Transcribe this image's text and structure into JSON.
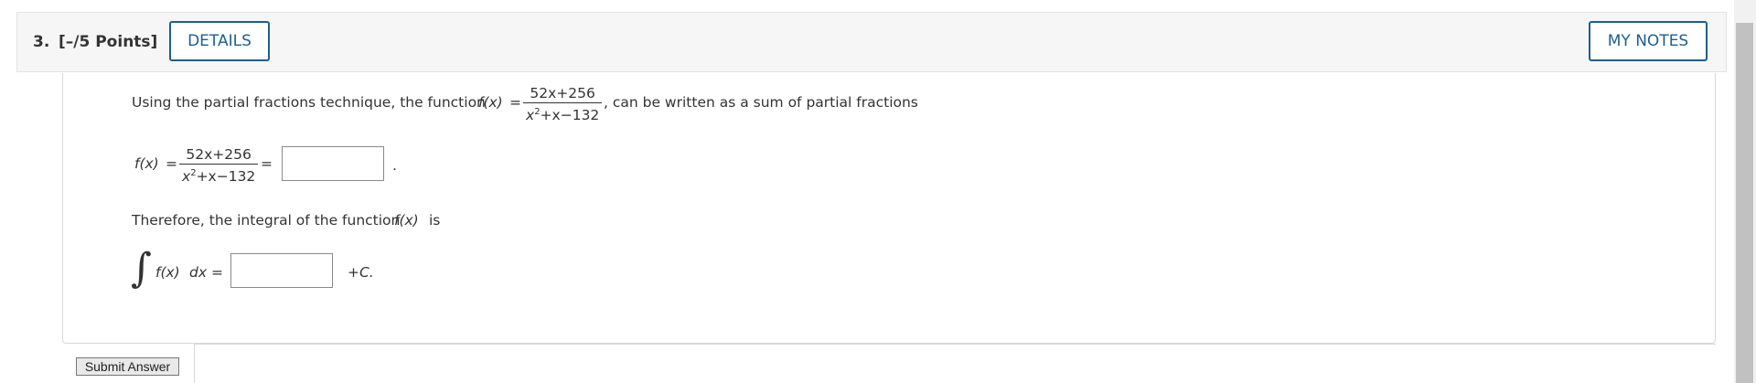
{
  "question": {
    "number": "3.",
    "points": "[–/5 Points]",
    "details_label": "DETAILS",
    "notes_label": "MY NOTES"
  },
  "problem": {
    "intro_before": "Using the partial fractions technique, the function",
    "fx": "f(x)",
    "equals": "=",
    "numerator": "52x+256",
    "denominator_base": "x",
    "denominator_exp": "2",
    "denominator_rest": "+x−132",
    "intro_after": ", can be written as a sum of partial fractions",
    "period": ".",
    "therefore": "Therefore, the integral of the function",
    "is": "is",
    "integral_sign": "∫",
    "integrand": "f(x)",
    "dx": "dx",
    "plus_c": "+C."
  },
  "inputs": {
    "partial_fractions_value": "",
    "integral_value": ""
  },
  "footer": {
    "submit_label": "Submit Answer"
  },
  "colors": {
    "accent": "#1d5f8f",
    "header_bg": "#f6f6f6",
    "border": "#d9d9d9"
  }
}
